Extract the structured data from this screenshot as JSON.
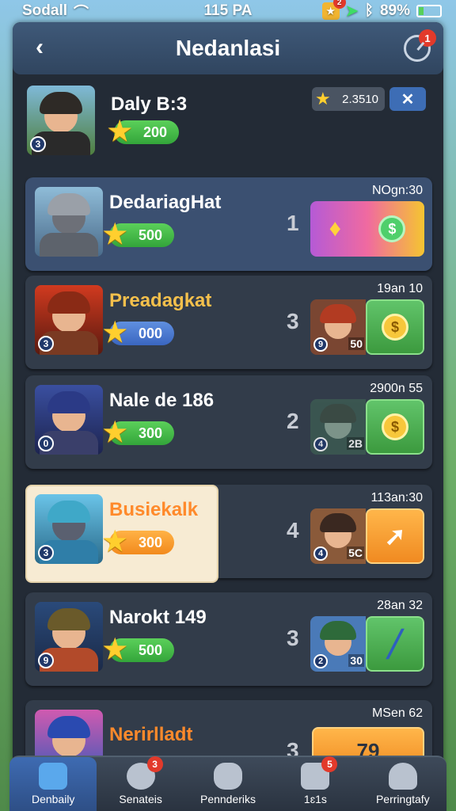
{
  "status_bar": {
    "carrier": "Sodall",
    "time": "115 PA",
    "notification_count": "2",
    "battery": "89%",
    "battery_level": 0.2
  },
  "header": {
    "title": "Nedanlasi",
    "timer_badge": "1"
  },
  "entries": [
    {
      "name": "Daly B:3",
      "points": "200",
      "level": "3",
      "coins": "2.3510",
      "close_symbol": "✕"
    },
    {
      "name": "DedariagHat",
      "points": "500",
      "time": "NOgn:30",
      "rank": "1"
    },
    {
      "name": "Preadagkat",
      "points": "000",
      "level": "3",
      "time": "19an 10",
      "rank": "3",
      "reward_level": "9",
      "reward_value": "50"
    },
    {
      "name": "Nale de 186",
      "points": "300",
      "level": "0",
      "time": "2900n 55",
      "rank": "2",
      "reward_level": "4",
      "reward_value": "2B"
    },
    {
      "name": "Busiekalk",
      "points": "300",
      "level": "3",
      "time": "113an:30",
      "rank": "4",
      "reward_level": "4",
      "reward_value": "5C"
    },
    {
      "name": "Narokt 149",
      "points": "500",
      "level": "9",
      "time": "28an 32",
      "rank": "3",
      "reward_level": "2",
      "reward_value": "30"
    },
    {
      "name": "Nerirlladt",
      "time": "MSen 62",
      "rank": "3",
      "reward_value": "79"
    }
  ],
  "bottom_nav": [
    {
      "label": "Denbaily"
    },
    {
      "label": "Senateis",
      "badge": "3"
    },
    {
      "label": "Pennderiks"
    },
    {
      "label": "1ɛ1s",
      "badge": "5"
    },
    {
      "label": "Perringtafy"
    }
  ],
  "colors": {
    "panel": "#232b36",
    "accent_blue": "#3e6bb2",
    "points_green": "#33a53a",
    "notification_red": "#e23a2b"
  }
}
